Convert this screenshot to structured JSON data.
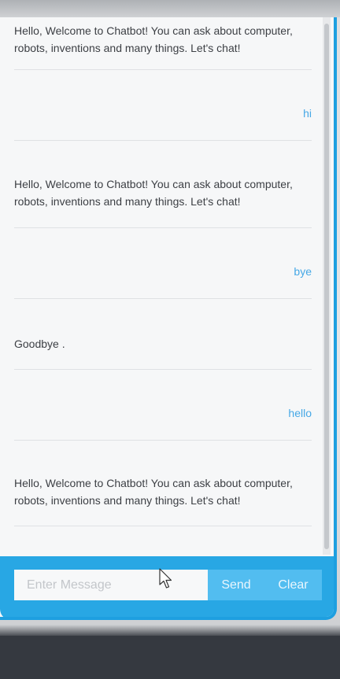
{
  "chat": {
    "messages": [
      {
        "sender": "bot",
        "text": "Hello, Welcome to Chatbot! You can ask about computer, robots, inventions and many things. Let's chat!"
      },
      {
        "sender": "user",
        "text": "hi"
      },
      {
        "sender": "bot",
        "text": "Hello, Welcome to Chatbot! You can ask about computer, robots, inventions and many things. Let's chat!"
      },
      {
        "sender": "user",
        "text": "bye"
      },
      {
        "sender": "bot",
        "text": "Goodbye ."
      },
      {
        "sender": "user",
        "text": "hello"
      },
      {
        "sender": "bot",
        "text": "Hello, Welcome to Chatbot! You can ask about computer, robots, inventions and many things. Let's chat!"
      }
    ]
  },
  "input": {
    "placeholder": "Enter Message",
    "value": ""
  },
  "buttons": {
    "send_label": "Send",
    "clear_label": "Clear"
  },
  "colors": {
    "accent": "#28a7e4",
    "user_text": "#46a8e6",
    "bot_text": "#3c3f44"
  },
  "icons": {
    "cursor": "mouse-pointer-icon"
  }
}
